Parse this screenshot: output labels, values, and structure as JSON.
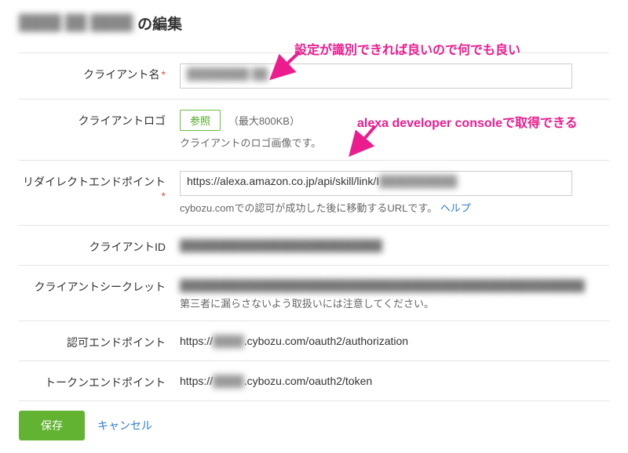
{
  "page": {
    "title_prefix_redacted": "████ ██ ████",
    "title_suffix": " の編集"
  },
  "annotations": {
    "top": "設定が識別できれば良いので何でも良い",
    "middle": "alexa developer consoleで取得できる"
  },
  "form": {
    "client_name": {
      "label": "クライアント名",
      "value_redacted": "████████ ██"
    },
    "client_logo": {
      "label": "クライアントロゴ",
      "browse_label": "参照",
      "max_note": "（最大800KB）",
      "help": "クライアントのロゴ画像です。"
    },
    "redirect_endpoint": {
      "label": "リダイレクトエンドポイント",
      "value_prefix": "https://alexa.amazon.co.jp/api/skill/link/I",
      "value_suffix_redacted": "██████████",
      "help": "cybozu.comでの認可が成功した後に移動するURLです。",
      "help_link": "ヘルプ"
    },
    "client_id": {
      "label": "クライアントID",
      "value_redacted": "██████████████████████████"
    },
    "client_secret": {
      "label": "クライアントシークレット",
      "value_redacted": "████████████████████████████████████████████████████",
      "help": "第三者に漏らさないよう取扱いには注意してください。"
    },
    "auth_endpoint": {
      "label": "認可エンドポイント",
      "value_prefix": "https://",
      "value_mid_redacted": "████",
      "value_suffix": ".cybozu.com/oauth2/authorization"
    },
    "token_endpoint": {
      "label": "トークンエンドポイント",
      "value_prefix": "https://",
      "value_mid_redacted": "████",
      "value_suffix": ".cybozu.com/oauth2/token"
    }
  },
  "footer": {
    "save": "保存",
    "cancel": "キャンセル"
  }
}
